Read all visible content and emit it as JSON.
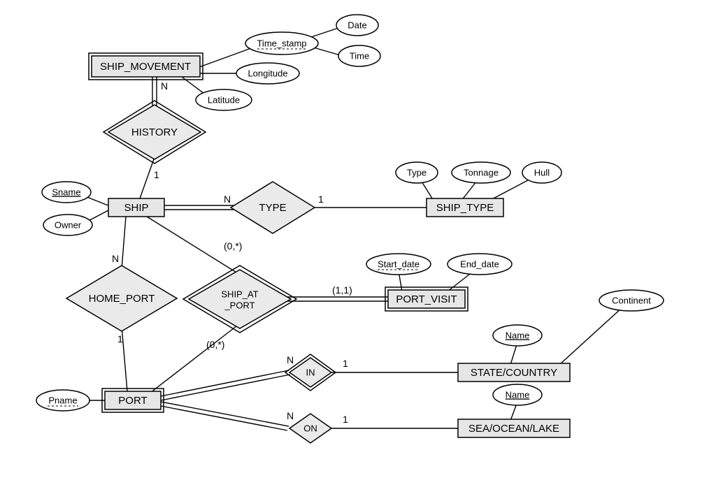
{
  "diagram_type": "Entity-Relationship Diagram",
  "entities": {
    "ship_movement": "SHIP_MOVEMENT",
    "ship": "SHIP",
    "ship_type": "SHIP_TYPE",
    "port_visit": "PORT_VISIT",
    "port": "PORT",
    "state_country": "STATE/COUNTRY",
    "sea_ocean_lake": "SEA/OCEAN/LAKE"
  },
  "relationships": {
    "history": "HISTORY",
    "type": "TYPE",
    "home_port": "HOME_PORT",
    "ship_at_port": "SHIP_AT\n_PORT",
    "ship_at_port_l1": "SHIP_AT",
    "ship_at_port_l2": "_PORT",
    "in": "IN",
    "on": "ON"
  },
  "attributes": {
    "time_stamp": "Time_stamp",
    "date": "Date",
    "time": "Time",
    "longitude": "Longitude",
    "latitude": "Latitude",
    "sname": "Sname",
    "owner": "Owner",
    "type": "Type",
    "tonnage": "Tonnage",
    "hull": "Hull",
    "start_date": "Start_date",
    "end_date": "End_date",
    "pname": "Pname",
    "name_sc": "Name",
    "continent": "Continent",
    "name_sol": "Name"
  },
  "cardinalities": {
    "history_n": "N",
    "history_1": "1",
    "type_n": "N",
    "type_1": "1",
    "home_port_n": "N",
    "home_port_1": "1",
    "ship_at_port_top": "(0,*)",
    "ship_at_port_right": "(1,1)",
    "ship_at_port_bottom": "(0,*)",
    "in_n": "N",
    "in_1": "1",
    "on_n": "N",
    "on_1": "1"
  }
}
